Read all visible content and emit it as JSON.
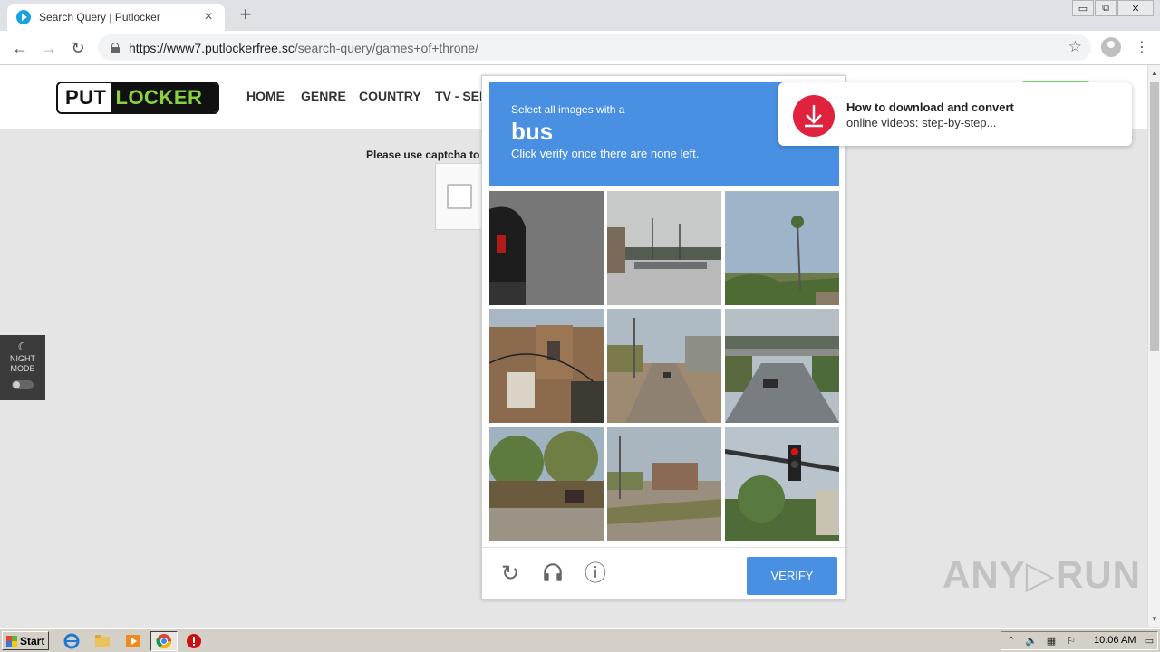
{
  "browser": {
    "tab_title": "Search Query | Putlocker",
    "tab_close": "×",
    "new_tab": "+",
    "url_host": "https://www7.putlockerfree.sc",
    "url_path": "/search-query/games+of+throne/",
    "back": "←",
    "forward": "→",
    "reload": "↻",
    "star": "☆",
    "menu": "⋮",
    "minimize": "▭",
    "restore": "⧉",
    "close": "✕"
  },
  "site": {
    "logo_put": "PUT",
    "logo_locker": "LOCKER",
    "nav": [
      "HOME",
      "GENRE",
      "COUNTRY",
      "TV - SER"
    ],
    "captcha_prompt": "Please use captcha to",
    "night_icon": "☾",
    "night_label_1": "NIGHT",
    "night_label_2": "MODE"
  },
  "captcha": {
    "instruction": "Select all images with a",
    "target": "bus",
    "help": "Click verify once there are none left.",
    "verify_label": "VERIFY",
    "refresh_icon": "↻",
    "info_icon": "ⓘ",
    "tiles": [
      "car-closeup",
      "parking-lot",
      "palm-tree",
      "brick-building",
      "street-road",
      "highway-overpass",
      "trees-road",
      "street-plaza",
      "traffic-light"
    ]
  },
  "notification": {
    "title": "How to download and convert",
    "text": "online videos: step-by-step..."
  },
  "watermark": "ANY▷RUN",
  "taskbar": {
    "start_label": "Start",
    "clock": "10:06 AM"
  }
}
